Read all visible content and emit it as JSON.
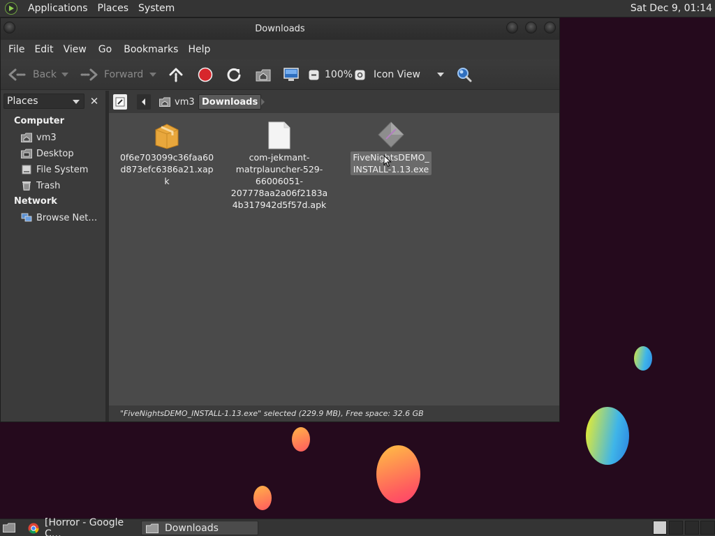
{
  "top_panel": {
    "menus": [
      "Applications",
      "Places",
      "System"
    ],
    "clock": "Sat Dec  9, 01:14"
  },
  "window": {
    "title": "Downloads",
    "menu": [
      "File",
      "Edit",
      "View",
      "Go",
      "Bookmarks",
      "Help"
    ],
    "toolbar": {
      "back": "Back",
      "forward": "Forward",
      "zoom": "100%",
      "view_mode": "Icon View"
    },
    "sidebar": {
      "title": "Places",
      "sections": [
        {
          "heading": "Computer",
          "items": [
            "vm3",
            "Desktop",
            "File System",
            "Trash"
          ]
        },
        {
          "heading": "Network",
          "items": [
            "Browse Net…"
          ]
        }
      ]
    },
    "pathbar": {
      "segments": [
        "vm3",
        "Downloads"
      ]
    },
    "files": [
      {
        "name_lines": [
          "0f6e703099c36faa60",
          "d873efc6386a21.xapk"
        ],
        "icon": "package-icon"
      },
      {
        "name_lines": [
          "com-jekmant-",
          "matrplauncher-529-",
          "66006051-",
          "207778aa2a06f2183a",
          "4b317942d5f57d.apk"
        ],
        "icon": "document-icon"
      },
      {
        "name_lines": [
          "FiveNightsDEMO_",
          "INSTALL-1.13.exe"
        ],
        "icon": "executable-icon",
        "selected": true
      }
    ],
    "status": "\"FiveNightsDEMO_INSTALL-1.13.exe\" selected (229.9 MB), Free space: 32.6 GB"
  },
  "taskbar": {
    "tasks": [
      "[Horror - Google C…",
      "Downloads"
    ]
  },
  "colors": {
    "desktop_bg": "#250a1d",
    "panel_bg": "#343434",
    "window_bg": "#3c3c3c",
    "content_bg": "#4a4a4a",
    "stop_red": "#d7262c"
  }
}
